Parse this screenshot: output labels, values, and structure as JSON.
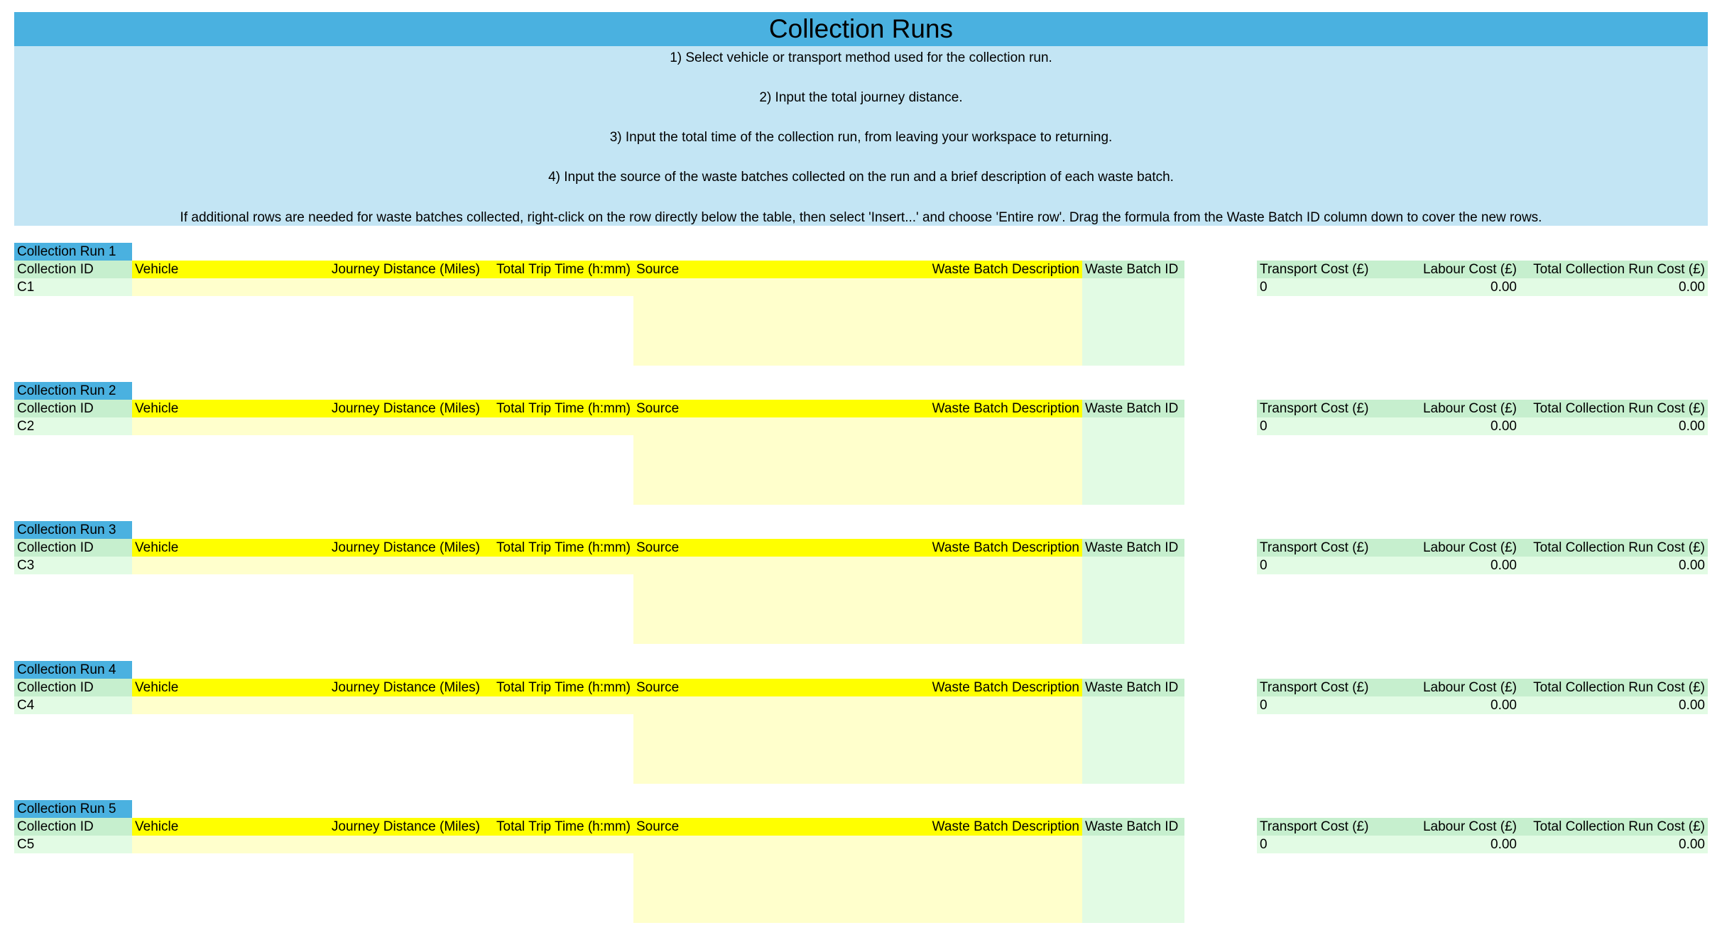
{
  "title": "Collection Runs",
  "instructions": [
    "1) Select vehicle or transport method used for the collection run.",
    "2) Input the total journey distance.",
    "3) Input the total time of the collection run, from leaving your workspace to returning.",
    "4) Input the source of the waste batches collected on the run and a brief description of each waste batch.",
    "If additional rows are needed for waste batches collected, right-click on the row directly below the table, then select 'Insert...' and choose 'Entire row'. Drag the formula from the Waste Batch ID column down to cover the new rows."
  ],
  "headers": {
    "collection_id": "Collection ID",
    "vehicle": "Vehicle",
    "journey_distance": "Journey Distance (Miles)",
    "trip_time": "Total Trip Time (h:mm)",
    "source": "Source",
    "waste_batch_description": "Waste Batch Description",
    "waste_batch_id": "Waste Batch ID",
    "transport_cost": "Transport Cost (£)",
    "labour_cost": "Labour Cost (£)",
    "total_cost": "Total Collection Run Cost (£)"
  },
  "runs": [
    {
      "title": "Collection Run 1",
      "id": "C1",
      "transport_cost": "0",
      "labour_cost": "0.00",
      "total_cost": "0.00"
    },
    {
      "title": "Collection Run 2",
      "id": "C2",
      "transport_cost": "0",
      "labour_cost": "0.00",
      "total_cost": "0.00"
    },
    {
      "title": "Collection Run 3",
      "id": "C3",
      "transport_cost": "0",
      "labour_cost": "0.00",
      "total_cost": "0.00"
    },
    {
      "title": "Collection Run 4",
      "id": "C4",
      "transport_cost": "0",
      "labour_cost": "0.00",
      "total_cost": "0.00"
    },
    {
      "title": "Collection Run 5",
      "id": "C5",
      "transport_cost": "0",
      "labour_cost": "0.00",
      "total_cost": "0.00"
    }
  ]
}
